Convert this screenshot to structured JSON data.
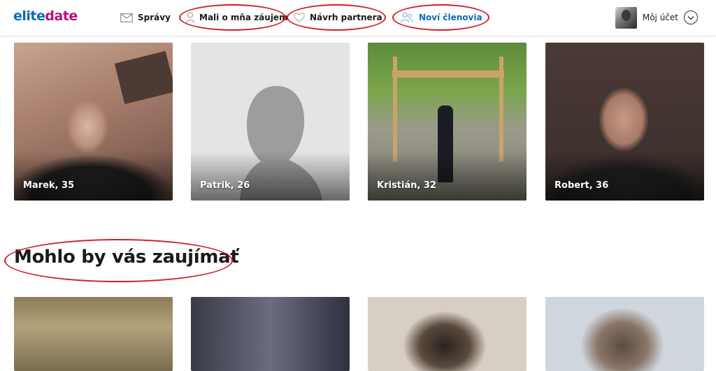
{
  "brand": {
    "logo_part1": "elite",
    "logo_part2": "date"
  },
  "nav": {
    "messages": {
      "label": "Správy",
      "icon": "envelope-icon"
    },
    "interested": {
      "label": "Mali o mňa záujem",
      "icon": "person-icon"
    },
    "partner": {
      "label": "Návrh partnera",
      "icon": "heart-icon"
    },
    "new_members": {
      "label": "Noví členovia",
      "icon": "people-icon"
    }
  },
  "account": {
    "label": "Môj účet",
    "icon": "chevron-down-icon"
  },
  "colors": {
    "accent_blue": "#0b6cb5",
    "brand_magenta": "#b5127a",
    "highlight_red": "#d01e2a"
  },
  "profiles": [
    {
      "name": "Marek, 35"
    },
    {
      "name": "Patrik, 26"
    },
    {
      "name": "Kristián, 32"
    },
    {
      "name": "Robert, 36"
    }
  ],
  "section": {
    "title": "Mohlo by vás zaujímať"
  }
}
